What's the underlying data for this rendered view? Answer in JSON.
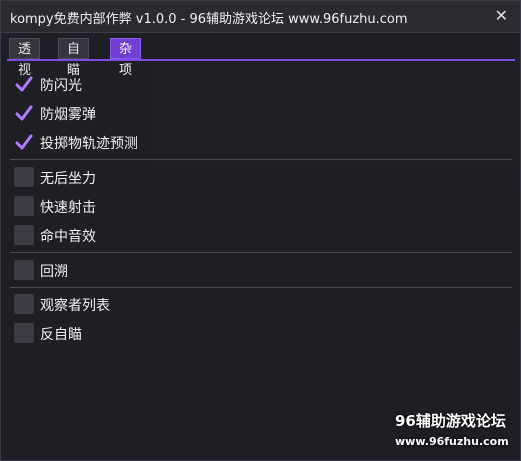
{
  "window": {
    "title": "kompy免费内部作弊 v1.0.0 - 96辅助游戏论坛 www.96fuzhu.com",
    "close_glyph": "✕"
  },
  "tabs": [
    {
      "label": "透视",
      "active": false
    },
    {
      "label": "自瞄",
      "active": false
    },
    {
      "label": "杂项",
      "active": true
    }
  ],
  "options": [
    {
      "label": "防闪光",
      "checked": true
    },
    {
      "label": "防烟雾弹",
      "checked": true
    },
    {
      "label": "投掷物轨迹预测",
      "checked": true
    },
    {
      "label": "无后坐力",
      "checked": false
    },
    {
      "label": "快速射击",
      "checked": false
    },
    {
      "label": "命中音效",
      "checked": false
    },
    {
      "label": "回溯",
      "checked": false
    },
    {
      "label": "观察者列表",
      "checked": false
    },
    {
      "label": "反自瞄",
      "checked": false
    }
  ],
  "watermark": {
    "line1": "96辅助游戏论坛",
    "line2": "www.96fuzhu.com"
  },
  "colors": {
    "accent": "#7b4ae0",
    "check": "#b07cff"
  }
}
